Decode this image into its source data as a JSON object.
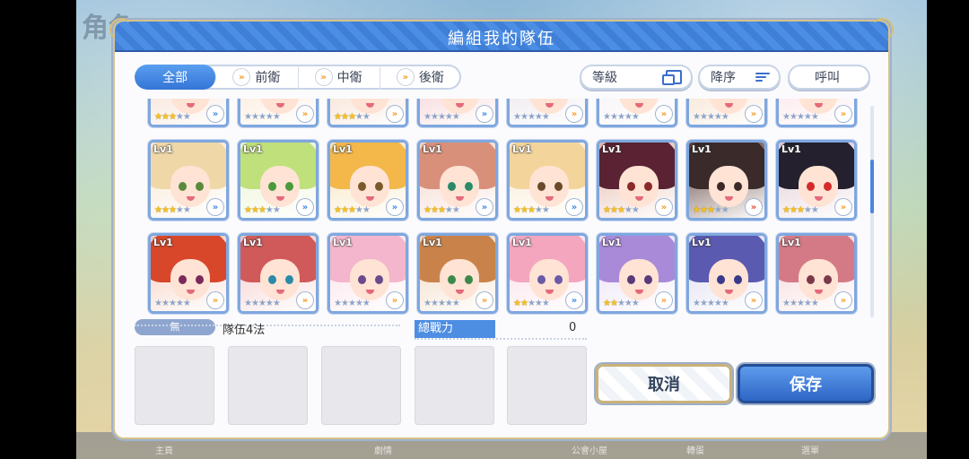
{
  "background": {
    "title": "角色",
    "nav": [
      "主頁",
      "",
      "劇情",
      "",
      "",
      "公會小屋",
      "轉蛋",
      "選單"
    ]
  },
  "dialog": {
    "title": "編組我的隊伍"
  },
  "tabs": [
    {
      "label": "全部",
      "active": true
    },
    {
      "label": "前衛",
      "active": false
    },
    {
      "label": "中衛",
      "active": false
    },
    {
      "label": "後衛",
      "active": false
    }
  ],
  "sort": {
    "level_label": "等級",
    "order_label": "降序",
    "call_label": "呼叫"
  },
  "characters": [
    {
      "lv": "",
      "stars": 3,
      "badge": "blue",
      "hair": "#d9b98a",
      "eye": "#7a5a3a",
      "bg": "#f4d7c6"
    },
    {
      "lv": "",
      "stars": 0,
      "badge": "orange",
      "hair": "#f2c79a",
      "eye": "#5a7aa8",
      "bg": "#fbe3cf"
    },
    {
      "lv": "",
      "stars": 3,
      "badge": "orange",
      "hair": "#b8754b",
      "eye": "#6a4a2a",
      "bg": "#f2d4be"
    },
    {
      "lv": "",
      "stars": 0,
      "badge": "blue",
      "hair": "#d6707a",
      "eye": "#6a3a3a",
      "bg": "#f3c4c8"
    },
    {
      "lv": "",
      "stars": 0,
      "badge": "orange",
      "hair": "#2b2b38",
      "eye": "#6a5a8a",
      "bg": "#e5dde6"
    },
    {
      "lv": "",
      "stars": 0,
      "badge": "orange",
      "hair": "#f1e9f0",
      "eye": "#8a7aa8",
      "bg": "#f4edf3"
    },
    {
      "lv": "",
      "stars": 0,
      "badge": "orange",
      "hair": "#e0a26a",
      "eye": "#7a4a2a",
      "bg": "#f3d7bd"
    },
    {
      "lv": "",
      "stars": 0,
      "badge": "orange",
      "hair": "#f3a6b6",
      "eye": "#8a4a5a",
      "bg": "#fbdbe2"
    },
    {
      "lv": "Lv1",
      "stars": 3,
      "badge": "blue",
      "hair": "#f0d7a8",
      "eye": "#5a8a3a",
      "bg": "#f9e6d0"
    },
    {
      "lv": "Lv1",
      "stars": 3,
      "badge": "blue",
      "hair": "#bfe07a",
      "eye": "#4a9a3a",
      "bg": "#e9f3cf"
    },
    {
      "lv": "Lv1",
      "stars": 3,
      "badge": "blue",
      "hair": "#f3b74a",
      "eye": "#7a5a2a",
      "bg": "#f8e3b8"
    },
    {
      "lv": "Lv1",
      "stars": 3,
      "badge": "blue",
      "hair": "#d8907a",
      "eye": "#2a8a6a",
      "bg": "#f4d2c6"
    },
    {
      "lv": "Lv1",
      "stars": 3,
      "badge": "blue",
      "hair": "#f3d49a",
      "eye": "#6a4a2a",
      "bg": "#f9e8cf"
    },
    {
      "lv": "Lv1",
      "stars": 3,
      "badge": "orange",
      "hair": "#5a2232",
      "eye": "#8a2a2a",
      "bg": "#e5b8a8"
    },
    {
      "lv": "Lv1",
      "stars": 3,
      "badge": "red",
      "hair": "#3a2a2a",
      "eye": "#3a2a2a",
      "bg": "#5a3a34"
    },
    {
      "lv": "Lv1",
      "stars": 3,
      "badge": "orange",
      "hair": "#24202e",
      "eye": "#d42a2a",
      "bg": "#e0c8d2"
    },
    {
      "lv": "Lv1",
      "stars": 0,
      "badge": "orange",
      "hair": "#d8472a",
      "eye": "#7a2a5a",
      "bg": "#f6c9b9"
    },
    {
      "lv": "Lv1",
      "stars": 0,
      "badge": "orange",
      "hair": "#d05a5a",
      "eye": "#2a8aa8",
      "bg": "#f3c6c3"
    },
    {
      "lv": "Lv1",
      "stars": 0,
      "badge": "orange",
      "hair": "#f3b6cc",
      "eye": "#6a4a8a",
      "bg": "#fbdde8"
    },
    {
      "lv": "Lv1",
      "stars": 0,
      "badge": "orange",
      "hair": "#c9834a",
      "eye": "#3a8a4a",
      "bg": "#f1d6bd"
    },
    {
      "lv": "Lv1",
      "stars": 2,
      "badge": "blue",
      "hair": "#f4a6bf",
      "eye": "#6a5aa8",
      "bg": "#fbdbe6"
    },
    {
      "lv": "Lv1",
      "stars": 2,
      "badge": "orange",
      "hair": "#a98ad8",
      "eye": "#5a3a7a",
      "bg": "#e8dcf3"
    },
    {
      "lv": "Lv1",
      "stars": 0,
      "badge": "orange",
      "hair": "#5a5ab0",
      "eye": "#3a3a8a",
      "bg": "#dad8f0"
    },
    {
      "lv": "Lv1",
      "stars": 0,
      "badge": "orange",
      "hair": "#d47a86",
      "eye": "#7a3a4a",
      "bg": "#f6d2d4"
    }
  ],
  "team": {
    "badge": "無",
    "name": "隊伍4法",
    "power_label": "總戰力",
    "power_value": "0"
  },
  "buttons": {
    "cancel": "取消",
    "save": "保存"
  }
}
